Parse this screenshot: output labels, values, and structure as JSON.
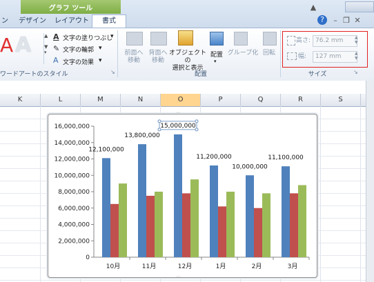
{
  "ribbon_tabs": {
    "context_group": "グラフ ツール",
    "tabs": [
      "ン",
      "デザイン",
      "レイアウト",
      "書式"
    ]
  },
  "wordart": {
    "fill_label": "文字の塗りつぶし",
    "outline_label": "文字の輪郭",
    "effect_label": "文字の効果",
    "group_label": "ワードアートのスタイル"
  },
  "arrange": {
    "bring_front": "前面へ\n移動",
    "send_back": "背面へ\n移動",
    "selection_pane": "オブジェクトの\n選択と表示",
    "align": "配置",
    "group": "グループ化",
    "rotate": "回転",
    "group_label": "配置"
  },
  "size": {
    "height_label": "高さ:",
    "height_value": "76.2 mm",
    "width_label": "幅:",
    "width_value": "127 mm",
    "group_label": "サイズ"
  },
  "columns": [
    "K",
    "L",
    "M",
    "N",
    "O",
    "P",
    "Q",
    "R",
    "S"
  ],
  "colors": {
    "series1": "#4f81bd",
    "series2": "#c0504d",
    "series3": "#9bbb59"
  },
  "chart_data": {
    "type": "bar",
    "categories": [
      "10月",
      "11月",
      "12月",
      "1月",
      "2月",
      "3月"
    ],
    "series": [
      {
        "values": [
          12100000,
          13800000,
          15000000,
          11200000,
          10000000,
          11100000
        ]
      },
      {
        "values": [
          6500000,
          7500000,
          7800000,
          6200000,
          6000000,
          7800000
        ]
      },
      {
        "values": [
          9000000,
          8000000,
          9500000,
          8000000,
          7800000,
          8800000
        ]
      }
    ],
    "data_labels": [
      "12,100,000",
      "13,800,000",
      "15,000,000",
      "11,200,000",
      "10,000,000",
      "11,100,000"
    ],
    "yticks": [
      "0",
      "2,000,000",
      "4,000,000",
      "6,000,000",
      "8,000,000",
      "10,000,000",
      "12,000,000",
      "14,000,000",
      "16,000,000"
    ],
    "ylim": [
      0,
      16000000
    ],
    "grid": false
  }
}
